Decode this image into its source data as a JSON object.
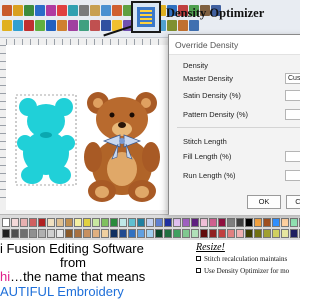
{
  "callout": {
    "label": "Density Optimizer"
  },
  "toolbar": {
    "row1": [
      "#c85a2a",
      "#d9a020",
      "#3c8c3c",
      "#2a6cc8",
      "#b03aa0",
      "#e04040",
      "#30a0b0",
      "#7a7a7a",
      "#c8a050",
      "#4a90d0",
      "#d06030",
      "#60a040",
      "#2050a0",
      "#a04070",
      "#e0b020",
      "#3070c0",
      "#c04040",
      "#50a050",
      "#806040",
      "#4060a0"
    ],
    "row2": [
      "#e0b020",
      "#30a0d0",
      "#c03030",
      "#60b040",
      "#2060c0",
      "#d08030",
      "#a040a0",
      "#40a080",
      "#c05050",
      "#3050a0",
      "#f0c030",
      "#7050b0",
      "#2080c0",
      "#d04080",
      "#50a0d0",
      "#809030",
      "#c07030",
      "#4070b0"
    ]
  },
  "dialog": {
    "title": "Override Density",
    "density_section": "Density",
    "master_density_label": "Master Density",
    "master_density_value": "Cus",
    "satin_density_label": "Satin Density (%)",
    "pattern_density_label": "Pattern Density (%)",
    "stitch_length_section": "Stitch Length",
    "fill_length_label": "Fill Length (%)",
    "run_length_label": "Run Length (%)",
    "ok_label": "OK",
    "cancel_label": "C"
  },
  "palette": {
    "row1": [
      "#ffffff",
      "#f4d9d9",
      "#e8b0b0",
      "#d06060",
      "#b02020",
      "#f0e0c0",
      "#e0c090",
      "#c09050",
      "#f5f0a0",
      "#e0d040",
      "#c8e8a0",
      "#80c060",
      "#2a8a3a",
      "#c0e8e8",
      "#60c0d0",
      "#2080a0",
      "#c0d0f0",
      "#6080d0",
      "#2030a0",
      "#e0c0f0",
      "#a060c0",
      "#602080",
      "#f0c0d8",
      "#d06090",
      "#901040",
      "#808080",
      "#404040",
      "#000000",
      "#f0a040",
      "#a05020",
      "#3090ff",
      "#ffd0a0",
      "#90e0b0",
      "#c0a0e0"
    ],
    "row2": [
      "#202020",
      "#505050",
      "#707070",
      "#909090",
      "#b0b0b0",
      "#d0d0d0",
      "#e8e8e8",
      "#8a5a2a",
      "#a87040",
      "#c89060",
      "#e0b080",
      "#f0d0a0",
      "#103060",
      "#204a90",
      "#3070c0",
      "#60a0e0",
      "#a0d0f0",
      "#0a4a2a",
      "#207040",
      "#40a060",
      "#80c890",
      "#b0e0b8",
      "#600a0a",
      "#902020",
      "#c04040",
      "#e08080",
      "#f0b0b0",
      "#404000",
      "#707010",
      "#a0a030",
      "#d0d060",
      "#e6e6a0",
      "#202060",
      "#505090"
    ]
  },
  "caption": {
    "line1": "i Fusion Editing Software",
    "line2": "from",
    "line3_pink": "hi",
    "line3_rest": "…the name that means",
    "line4": "AUTIFUL Embroidery",
    "resize_title": "Resize!",
    "bullet1": "Stitch recalculation maintains",
    "bullet2": "Use Density Optimizer for mo"
  }
}
